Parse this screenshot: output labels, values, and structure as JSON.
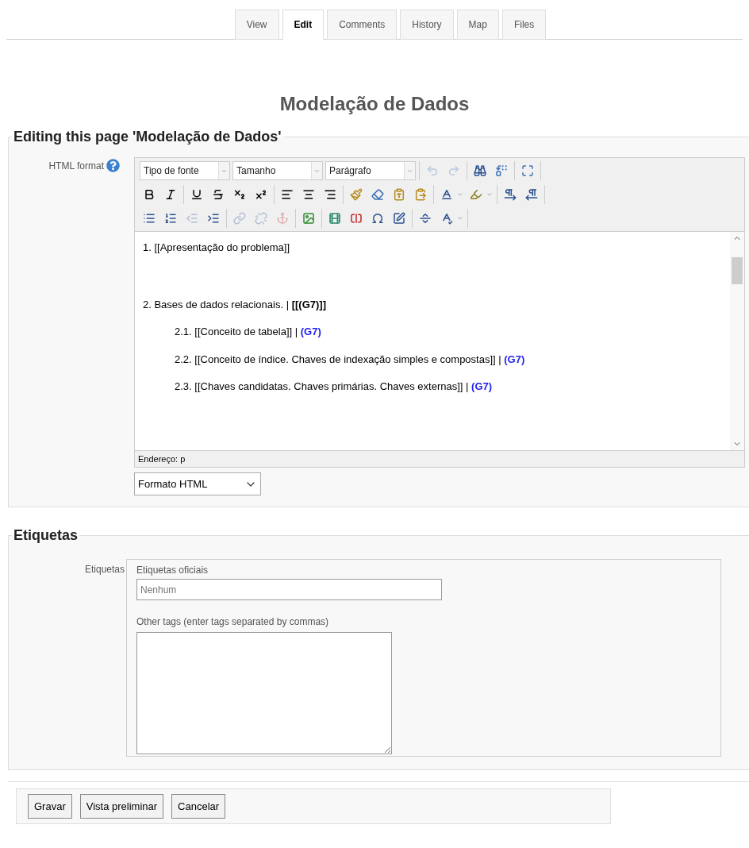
{
  "tabs": [
    {
      "label": "View",
      "selected": false
    },
    {
      "label": "Edit",
      "selected": true
    },
    {
      "label": "Comments",
      "selected": false
    },
    {
      "label": "History",
      "selected": false
    },
    {
      "label": "Map",
      "selected": false
    },
    {
      "label": "Files",
      "selected": false
    }
  ],
  "page_title": "Modelação de Dados",
  "editing": {
    "legend": "Editing this page 'Modelação de Dados'",
    "format_label": "HTML format",
    "toolbar": [
      [
        [
          {
            "kind": "select",
            "value": "Tipo de fonte"
          },
          {
            "kind": "select",
            "value": "Tamanho"
          },
          {
            "kind": "select",
            "value": "Parágrafo"
          }
        ],
        [
          {
            "kind": "undo",
            "disabled": true
          },
          {
            "kind": "redo",
            "disabled": true
          }
        ],
        [
          {
            "kind": "find",
            "disabled": false
          },
          {
            "kind": "replace",
            "disabled": false
          }
        ],
        [
          {
            "kind": "fullscreen",
            "disabled": false
          }
        ]
      ],
      [
        [
          {
            "kind": "bold",
            "disabled": false
          },
          {
            "kind": "italic",
            "disabled": false
          }
        ],
        [
          {
            "kind": "underline",
            "disabled": false
          },
          {
            "kind": "strike",
            "disabled": false
          },
          {
            "kind": "subscript",
            "disabled": false
          },
          {
            "kind": "superscript",
            "disabled": false
          }
        ],
        [
          {
            "kind": "align-left",
            "disabled": false
          },
          {
            "kind": "align-center",
            "disabled": false
          },
          {
            "kind": "align-right",
            "disabled": false
          }
        ],
        [
          {
            "kind": "cleanup",
            "disabled": false
          },
          {
            "kind": "eraser",
            "disabled": false
          },
          {
            "kind": "paste-text",
            "disabled": false
          },
          {
            "kind": "paste-word",
            "disabled": false
          }
        ],
        [
          {
            "kind": "text-color",
            "disabled": false,
            "dropdown": true
          },
          {
            "kind": "highlight",
            "disabled": false,
            "dropdown": true
          }
        ],
        [
          {
            "kind": "ltr",
            "disabled": false
          },
          {
            "kind": "rtl",
            "disabled": false
          }
        ]
      ],
      [
        [
          {
            "kind": "bullet-list",
            "disabled": false
          },
          {
            "kind": "numbered-list",
            "disabled": false
          },
          {
            "kind": "outdent",
            "disabled": true
          },
          {
            "kind": "indent",
            "disabled": false
          }
        ],
        [
          {
            "kind": "link",
            "disabled": true
          },
          {
            "kind": "unlink",
            "disabled": true
          },
          {
            "kind": "anchor",
            "disabled": true
          }
        ],
        [
          {
            "kind": "image",
            "disabled": false
          }
        ],
        [
          {
            "kind": "media",
            "disabled": false
          },
          {
            "kind": "nonbreaking",
            "disabled": false
          },
          {
            "kind": "charmap",
            "disabled": false
          },
          {
            "kind": "html",
            "disabled": false
          }
        ],
        [
          {
            "kind": "hr",
            "disabled": false
          },
          {
            "kind": "spellcheck",
            "disabled": false,
            "dropdown": true
          }
        ]
      ]
    ],
    "content": [
      {
        "parts": [
          {
            "kind": "text",
            "text": "1. [[Apresentação do problema]]"
          }
        ]
      },
      {
        "parts": [
          {
            "kind": "text",
            "text": "2. Bases de dados relacionais. | "
          },
          {
            "kind": "bold",
            "text": "[[(G7)]]"
          }
        ],
        "children": [
          {
            "parts": [
              {
                "kind": "text",
                "text": "2.1. [[Conceito de tabela]] | "
              },
              {
                "kind": "link",
                "text": "(G7)"
              }
            ]
          },
          {
            "parts": [
              {
                "kind": "text",
                "text": "2.2. [[Conceito de índice. Chaves de indexação simples e compostas]] | "
              },
              {
                "kind": "link",
                "text": "(G7)"
              }
            ]
          },
          {
            "parts": [
              {
                "kind": "text",
                "text": "2.3. [[Chaves candidatas. Chaves primárias. Chaves externas]] | "
              },
              {
                "kind": "link",
                "text": "(G7)"
              }
            ]
          }
        ]
      }
    ],
    "path": "Endereço: p",
    "format_select": "Formato HTML"
  },
  "tags": {
    "legend": "Etiquetas",
    "label": "Etiquetas",
    "official_label": "Etiquetas oficiais",
    "official_placeholder": "Nenhum",
    "other_label": "Other tags (enter tags separated by commas)"
  },
  "buttons": [
    "Gravar",
    "Vista preliminar",
    "Cancelar"
  ]
}
